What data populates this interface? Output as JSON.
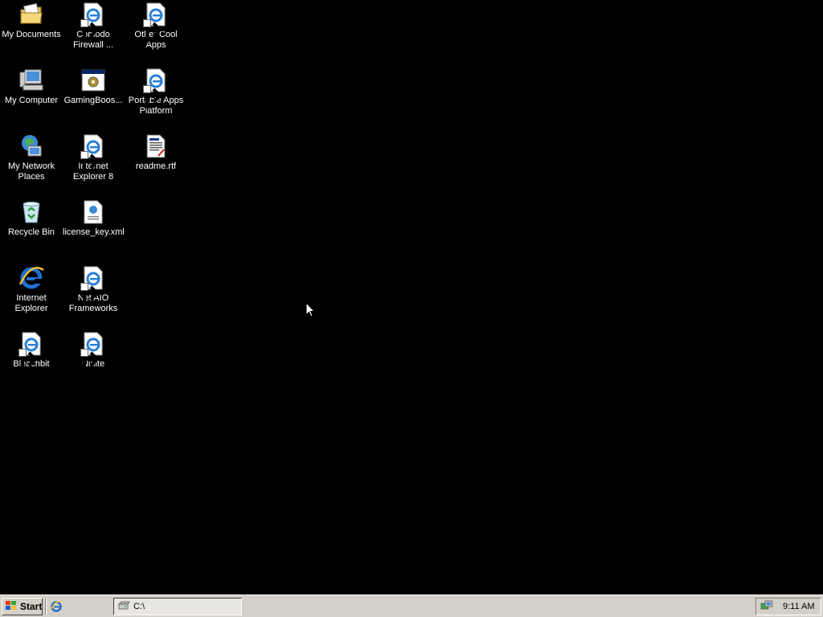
{
  "desktop": {
    "icons": [
      {
        "label": "My Documents",
        "icon": "folder-documents-icon"
      },
      {
        "label": "Comodo Firewall ...",
        "icon": "ie-shortcut-icon"
      },
      {
        "label": "Other Cool Apps",
        "icon": "ie-shortcut-icon"
      },
      {
        "label": "My Computer",
        "icon": "computer-icon"
      },
      {
        "label": "GamingBoos...",
        "icon": "app-window-icon"
      },
      {
        "label": "Portable Apps Platform",
        "icon": "ie-shortcut-icon"
      },
      {
        "label": "My Network Places",
        "icon": "network-places-icon"
      },
      {
        "label": "Internet Explorer 8",
        "icon": "ie-shortcut-icon"
      },
      {
        "label": "readme.rtf",
        "icon": "rtf-document-icon"
      },
      {
        "label": "Recycle Bin",
        "icon": "recycle-bin-icon"
      },
      {
        "label": "license_key.xml",
        "icon": "xml-document-icon"
      },
      {
        "label": "Internet Explorer",
        "icon": "internet-explorer-icon"
      },
      {
        "label": "Net AIO Frameworks",
        "icon": "ie-shortcut-icon"
      },
      {
        "label": "Bleachbit",
        "icon": "ie-shortcut-icon"
      },
      {
        "label": "Ninite",
        "icon": "ie-shortcut-icon"
      }
    ]
  },
  "taskbar": {
    "start_label": "Start",
    "quicklaunch_icon": "internet-explorer-icon",
    "task_label": "C:\\",
    "task_icon": "drive-icon",
    "clock": "9:11 AM",
    "tray_icon": "network-tray-icon"
  },
  "colors": {
    "desktop_bg": "#000000",
    "taskbar_bg": "#d4d0c8"
  }
}
